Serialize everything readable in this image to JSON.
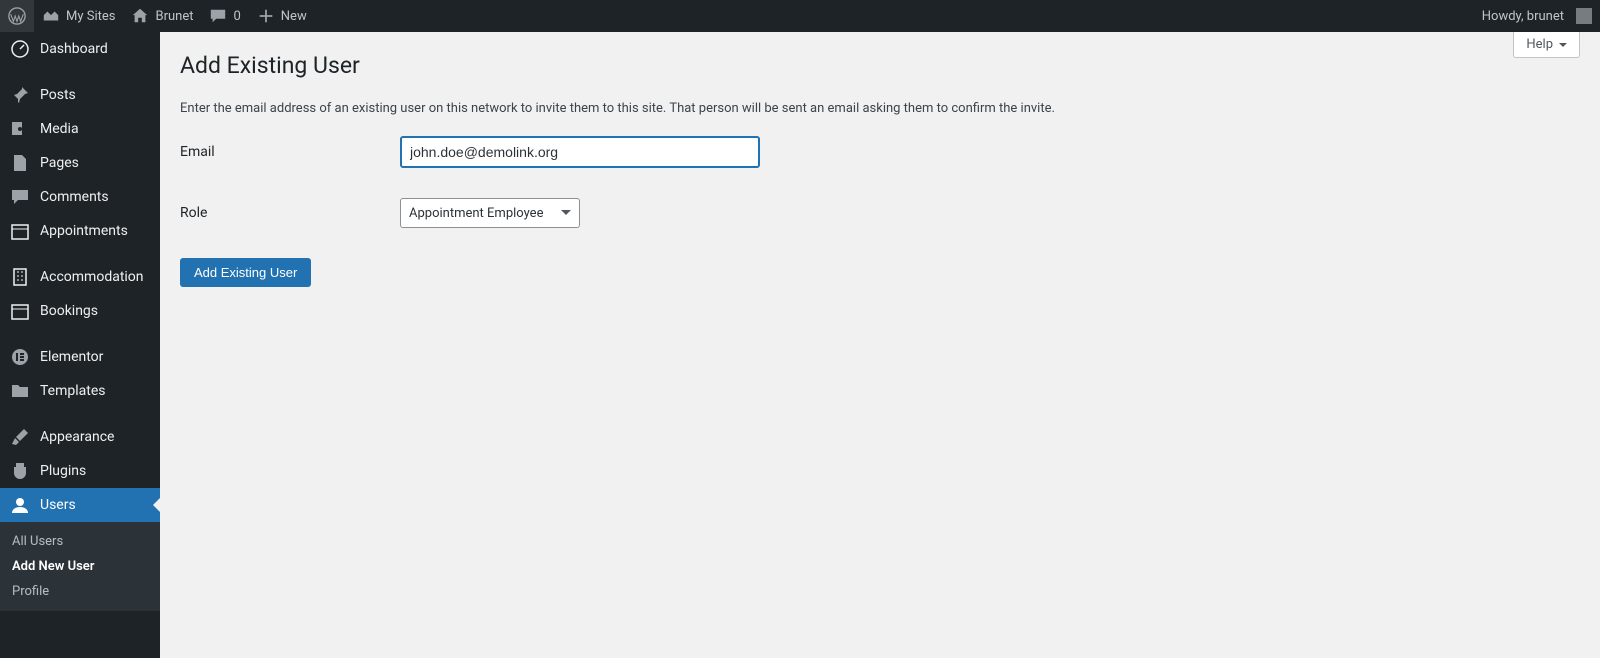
{
  "adminbar": {
    "my_sites": "My Sites",
    "site_name": "Brunet",
    "comments_count": "0",
    "new_label": "New",
    "howdy": "Howdy, brunet"
  },
  "sidebar": {
    "items": [
      {
        "label": "Dashboard"
      },
      {
        "label": "Posts"
      },
      {
        "label": "Media"
      },
      {
        "label": "Pages"
      },
      {
        "label": "Comments"
      },
      {
        "label": "Appointments"
      },
      {
        "label": "Accommodation"
      },
      {
        "label": "Bookings"
      },
      {
        "label": "Elementor"
      },
      {
        "label": "Templates"
      },
      {
        "label": "Appearance"
      },
      {
        "label": "Plugins"
      },
      {
        "label": "Users"
      }
    ],
    "submenu": {
      "all_users": "All Users",
      "add_new_user": "Add New User",
      "profile": "Profile"
    }
  },
  "content": {
    "help_label": "Help",
    "heading": "Add Existing User",
    "description": "Enter the email address of an existing user on this network to invite them to this site. That person will be sent an email asking them to confirm the invite.",
    "email_label": "Email",
    "email_value": "john.doe@demolink.org",
    "role_label": "Role",
    "role_value": "Appointment Employee",
    "submit_label": "Add Existing User"
  }
}
